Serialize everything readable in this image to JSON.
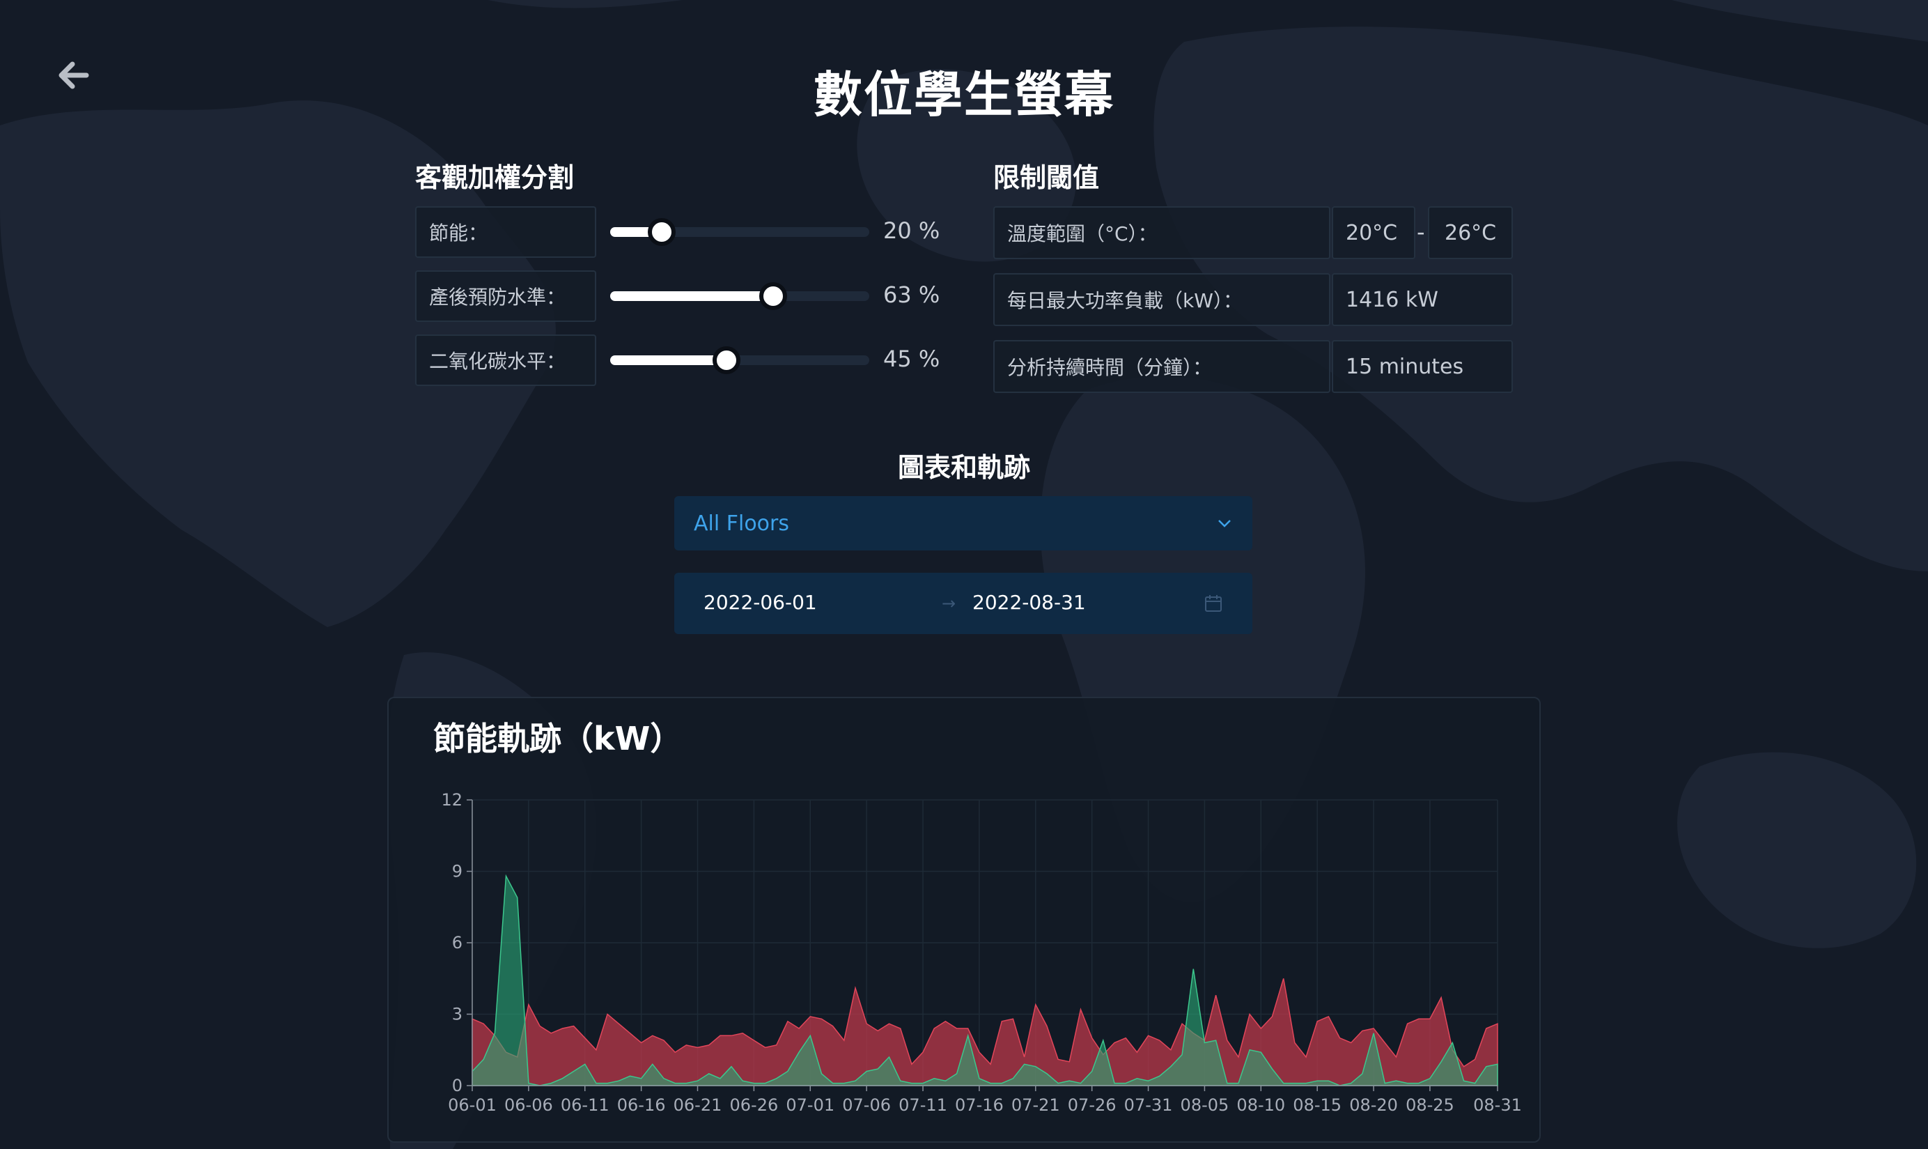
{
  "page": {
    "title": "數位學生螢幕"
  },
  "weights": {
    "heading": "客觀加權分割",
    "items": [
      {
        "label": "節能：",
        "value": 20,
        "value_text": "20 %"
      },
      {
        "label": "產後預防水準：",
        "value": 63,
        "value_text": "63 %"
      },
      {
        "label": "二氧化碳水平：",
        "value": 45,
        "value_text": "45 %"
      }
    ]
  },
  "thresholds": {
    "heading": "限制閾值",
    "temp_label": "溫度範圍（°C）：",
    "temp_min": "20°C",
    "temp_sep": "-",
    "temp_max": "26°C",
    "power_label": "每日最大功率負載（kW）：",
    "power_value": "1416 kW",
    "duration_label": "分析持續時間（分鐘）：",
    "duration_value": "15 minutes"
  },
  "charts_section": {
    "heading": "圖表和軌跡",
    "floor_select": "All Floors",
    "date_start": "2022-06-01",
    "date_sep": "→",
    "date_end": "2022-08-31"
  },
  "colors": {
    "series_red": "#c0394b",
    "series_green": "#2aa876",
    "accent": "#3ea3ea"
  },
  "icons": {
    "back": "arrow-left-icon",
    "dropdown": "chevron-down-icon",
    "calendar": "calendar-icon"
  },
  "chart_data": {
    "type": "area",
    "title": "節能軌跡（kW）",
    "ylim": [
      0,
      12
    ],
    "yticks": [
      0,
      3,
      6,
      9,
      12
    ],
    "xtick_labels": [
      "06-01",
      "06-06",
      "06-11",
      "06-16",
      "06-21",
      "06-26",
      "07-01",
      "07-06",
      "07-11",
      "07-16",
      "07-21",
      "07-26",
      "07-31",
      "08-05",
      "08-10",
      "08-15",
      "08-20",
      "08-25",
      "08-31"
    ],
    "x": [
      "06-01",
      "06-02",
      "06-03",
      "06-04",
      "06-05",
      "06-06",
      "06-07",
      "06-08",
      "06-09",
      "06-10",
      "06-11",
      "06-12",
      "06-13",
      "06-14",
      "06-15",
      "06-16",
      "06-17",
      "06-18",
      "06-19",
      "06-20",
      "06-21",
      "06-22",
      "06-23",
      "06-24",
      "06-25",
      "06-26",
      "06-27",
      "06-28",
      "06-29",
      "06-30",
      "07-01",
      "07-02",
      "07-03",
      "07-04",
      "07-05",
      "07-06",
      "07-07",
      "07-08",
      "07-09",
      "07-10",
      "07-11",
      "07-12",
      "07-13",
      "07-14",
      "07-15",
      "07-16",
      "07-17",
      "07-18",
      "07-19",
      "07-20",
      "07-21",
      "07-22",
      "07-23",
      "07-24",
      "07-25",
      "07-26",
      "07-27",
      "07-28",
      "07-29",
      "07-30",
      "07-31",
      "08-01",
      "08-02",
      "08-03",
      "08-04",
      "08-05",
      "08-06",
      "08-07",
      "08-08",
      "08-09",
      "08-10",
      "08-11",
      "08-12",
      "08-13",
      "08-14",
      "08-15",
      "08-16",
      "08-17",
      "08-18",
      "08-19",
      "08-20",
      "08-21",
      "08-22",
      "08-23",
      "08-24",
      "08-25",
      "08-26",
      "08-27",
      "08-28",
      "08-29",
      "08-30",
      "08-31"
    ],
    "grid": true,
    "series": [
      {
        "values": [
          2.8,
          2.6,
          2.1,
          1.4,
          1.2,
          3.4,
          2.5,
          2.2,
          2.4,
          2.5,
          2.0,
          1.5,
          3.0,
          2.6,
          2.2,
          1.8,
          2.1,
          1.9,
          1.4,
          1.7,
          1.6,
          1.7,
          2.1,
          2.1,
          2.2,
          1.9,
          1.6,
          1.7,
          2.7,
          2.4,
          2.9,
          2.8,
          2.5,
          1.9,
          4.1,
          2.6,
          2.3,
          2.6,
          2.4,
          0.9,
          1.4,
          2.4,
          2.7,
          2.4,
          2.4,
          1.4,
          0.9,
          2.7,
          2.8,
          1.2,
          3.4,
          2.5,
          1.1,
          1.0,
          3.2,
          2.0,
          1.3,
          1.8,
          2.0,
          1.4,
          2.1,
          1.9,
          1.5,
          2.6,
          2.2,
          1.9,
          3.8,
          1.9,
          1.2,
          3.0,
          2.4,
          2.9,
          4.5,
          1.8,
          1.2,
          2.7,
          2.9,
          2.0,
          1.8,
          2.3,
          2.4,
          1.8,
          1.2,
          2.6,
          2.8,
          2.8,
          3.7,
          1.5,
          0.8,
          1.1,
          2.4,
          2.6
        ]
      },
      {
        "values": [
          0.6,
          1.1,
          2.2,
          8.8,
          7.9,
          0.1,
          0.0,
          0.1,
          0.3,
          0.6,
          0.9,
          0.1,
          0.1,
          0.2,
          0.4,
          0.3,
          0.9,
          0.3,
          0.1,
          0.1,
          0.2,
          0.5,
          0.3,
          0.8,
          0.2,
          0.1,
          0.1,
          0.3,
          0.6,
          1.4,
          2.1,
          0.5,
          0.1,
          0.1,
          0.2,
          0.6,
          0.7,
          1.2,
          0.2,
          0.1,
          0.1,
          0.3,
          0.2,
          0.5,
          2.1,
          0.3,
          0.1,
          0.1,
          0.3,
          0.9,
          0.8,
          0.5,
          0.1,
          0.2,
          0.1,
          0.6,
          1.9,
          0.1,
          0.1,
          0.3,
          0.2,
          0.4,
          0.8,
          1.3,
          4.9,
          1.8,
          1.9,
          0.1,
          0.1,
          1.5,
          1.4,
          0.7,
          0.1,
          0.1,
          0.1,
          0.2,
          0.2,
          0.0,
          0.1,
          0.5,
          2.2,
          0.1,
          0.2,
          0.1,
          0.1,
          0.3,
          1.0,
          1.8,
          0.2,
          0.1,
          0.8,
          0.9
        ]
      }
    ]
  }
}
